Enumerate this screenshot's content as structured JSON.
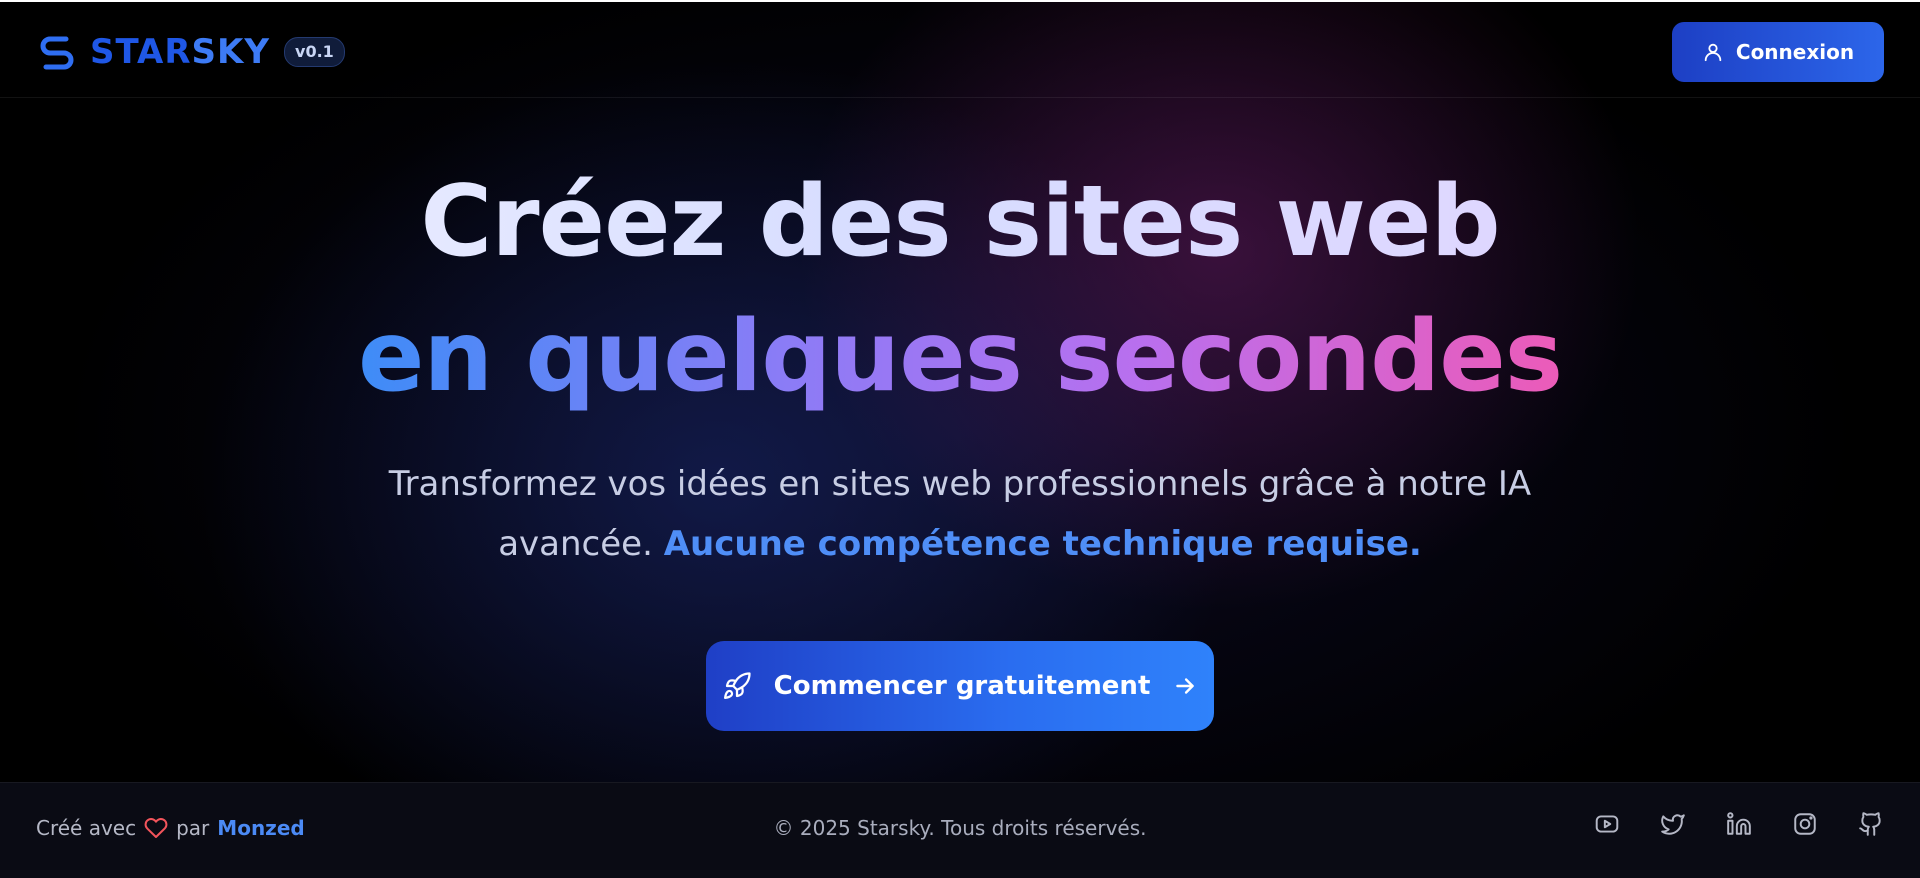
{
  "header": {
    "logo": {
      "star": "STAR",
      "sky": "SKY",
      "icon": "s-logo-icon"
    },
    "version": "v0.1",
    "login_label": "Connexion"
  },
  "hero": {
    "line1": "Créez des sites web",
    "line2": "en quelques secondes",
    "subtitle_main": "Transformez vos idées en sites web professionnels grâce à notre IA avancée.",
    "subtitle_highlight": "Aucune compétence technique requise.",
    "cta_label": "Commencer gratuitement"
  },
  "footer": {
    "credit_prefix": "Créé avec",
    "credit_middle": "par",
    "credit_author": "Monzed",
    "copyright": "© 2025 Starsky. Tous droits réservés.",
    "social": [
      "youtube-icon",
      "twitter-icon",
      "linkedin-icon",
      "instagram-icon",
      "github-icon"
    ]
  },
  "colors": {
    "accent": "#2c66ea",
    "highlight": "#4f8ef7",
    "heart": "#f2545b",
    "gradient_start": "#3e8cf7",
    "gradient_end": "#ec5bb8"
  }
}
